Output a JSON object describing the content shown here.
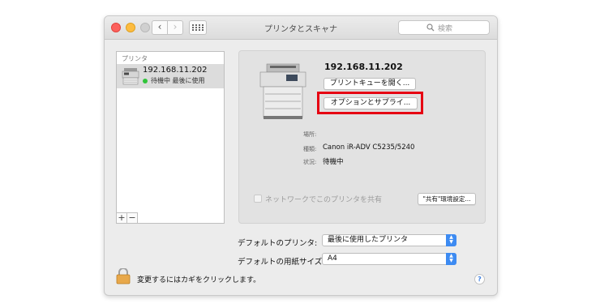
{
  "window": {
    "title": "プリンタとスキャナ"
  },
  "toolbar": {
    "back_glyph": "‹",
    "forward_glyph": "›",
    "search_placeholder": "検索"
  },
  "printers": {
    "header": "プリンタ",
    "items": [
      {
        "name": "192.168.11.202",
        "status": "待機中 最後に使用",
        "status_color": "#31c43a"
      }
    ],
    "add_glyph": "+",
    "remove_glyph": "−"
  },
  "detail": {
    "name": "192.168.11.202",
    "open_queue_label": "プリントキューを開く...",
    "options_label": "オプションとサプライ...",
    "location_label": "場所:",
    "location_value": "",
    "kind_label": "種類:",
    "kind_value": "Canon iR-ADV C5235/5240",
    "status_label": "状況:",
    "status_value": "待機中",
    "share_label": "ネットワークでこのプリンタを共有",
    "share_checked": false,
    "sharing_prefs_label": "\"共有\"環境設定..."
  },
  "defaults": {
    "printer_label": "デフォルトのプリンタ:",
    "printer_value": "最後に使用したプリンタ",
    "paper_label": "デフォルトの用紙サイズ:",
    "paper_value": "A4"
  },
  "footer": {
    "lock_text": "変更するにはカギをクリックします。",
    "help_glyph": "?"
  },
  "colors": {
    "highlight": "#e60012",
    "accent": "#3d8bf2"
  }
}
